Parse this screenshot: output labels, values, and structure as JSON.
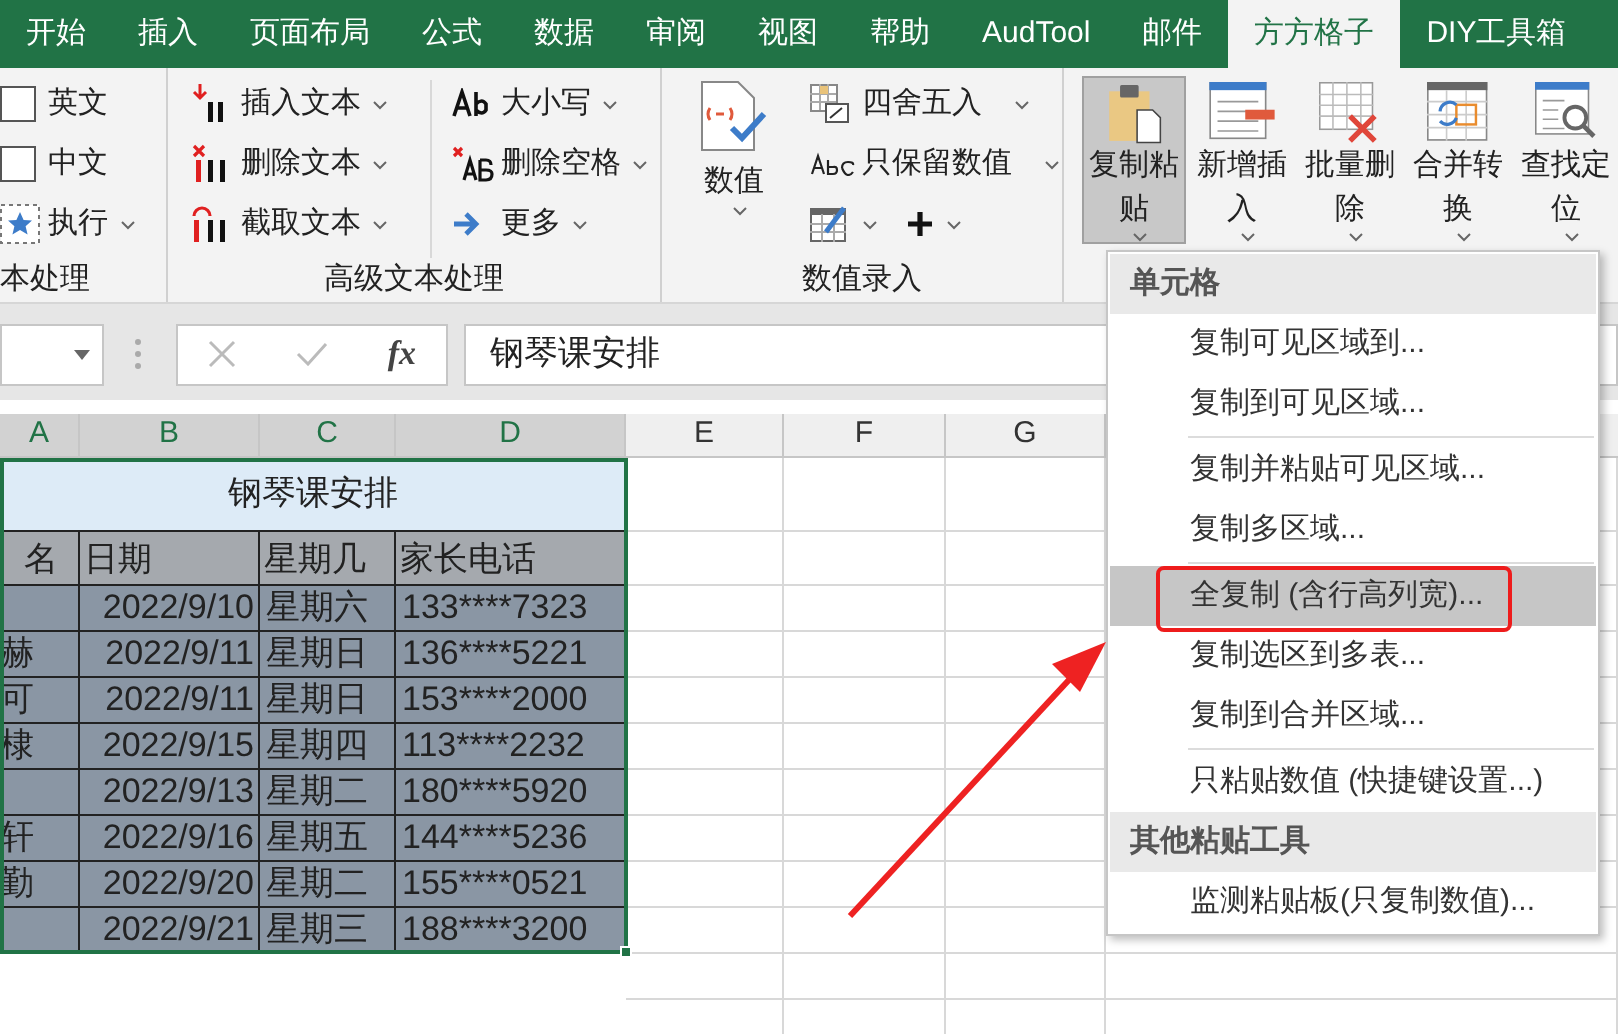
{
  "ribbon_tabs": [
    {
      "label": "开始",
      "selected": false
    },
    {
      "label": "插入",
      "selected": false
    },
    {
      "label": "页面布局",
      "selected": false
    },
    {
      "label": "公式",
      "selected": false
    },
    {
      "label": "数据",
      "selected": false
    },
    {
      "label": "审阅",
      "selected": false
    },
    {
      "label": "视图",
      "selected": false
    },
    {
      "label": "帮助",
      "selected": false
    },
    {
      "label": "AudTool",
      "selected": false
    },
    {
      "label": "邮件",
      "selected": false
    },
    {
      "label": "方方格子",
      "selected": true
    },
    {
      "label": "DIY工具箱",
      "selected": false
    }
  ],
  "ribbon": {
    "text_group": {
      "label": "本处理",
      "items": [
        {
          "kind": "checkbox",
          "label": "英文",
          "checked": false
        },
        {
          "kind": "checkbox",
          "label": "中文",
          "checked": false
        },
        {
          "kind": "command",
          "label": "执行",
          "dropdown": true
        }
      ]
    },
    "advanced_text_group": {
      "label": "高级文本处理",
      "columns": [
        [
          {
            "label": "插入文本",
            "dropdown": true
          },
          {
            "label": "删除文本",
            "dropdown": true
          },
          {
            "label": "截取文本",
            "dropdown": true
          }
        ],
        [
          {
            "label": "大小写",
            "dropdown": true
          },
          {
            "label": "删除空格",
            "dropdown": true
          },
          {
            "label": "更多",
            "dropdown": true
          }
        ]
      ]
    },
    "number_group": {
      "label": "数值录入",
      "large": {
        "label": "数值",
        "dropdown": true
      },
      "items": [
        {
          "label": "四舍五入",
          "dropdown": true
        },
        {
          "label": "只保留数值",
          "dropdown": true
        }
      ],
      "icon_items": [
        {
          "dropdown": true
        },
        {
          "dropdown": true
        }
      ]
    },
    "large_buttons": [
      {
        "label": "复制粘贴",
        "selected": true,
        "dropdown": true
      },
      {
        "label": "新增插入",
        "selected": false,
        "dropdown": true
      },
      {
        "label": "批量删除",
        "selected": false,
        "dropdown": true
      },
      {
        "label": "合并转换",
        "selected": false,
        "dropdown": true
      },
      {
        "label": "查找定位",
        "selected": false,
        "dropdown": true
      }
    ]
  },
  "formula_bar": {
    "function_label": "fx",
    "value": "钢琴课安排"
  },
  "sheet": {
    "columns": [
      {
        "label": "A",
        "selected": true
      },
      {
        "label": "B",
        "selected": true
      },
      {
        "label": "C",
        "selected": true
      },
      {
        "label": "D",
        "selected": true
      },
      {
        "label": "E",
        "selected": false
      },
      {
        "label": "F",
        "selected": false
      },
      {
        "label": "G",
        "selected": false
      }
    ],
    "title": "钢琴课安排",
    "header": [
      "名",
      "日期",
      "星期几",
      "家长电话"
    ],
    "rows": [
      [
        "",
        "2022/9/10",
        "星期六",
        "133****7323"
      ],
      [
        "赫",
        "2022/9/11",
        "星期日",
        "136****5221"
      ],
      [
        "可",
        "2022/9/11",
        "星期日",
        "153****2000"
      ],
      [
        "棣",
        "2022/9/15",
        "星期四",
        "113****2232"
      ],
      [
        "",
        "2022/9/13",
        "星期二",
        "180****5920"
      ],
      [
        "轩",
        "2022/9/16",
        "星期五",
        "144****5236"
      ],
      [
        "勤",
        "2022/9/20",
        "星期二",
        "155****0521"
      ],
      [
        "",
        "2022/9/21",
        "星期三",
        "188****3200"
      ]
    ]
  },
  "context_menu": {
    "items": [
      {
        "kind": "header",
        "label": "单元格"
      },
      {
        "kind": "item",
        "label": "复制可见区域到...",
        "selected": false
      },
      {
        "kind": "item",
        "label": "复制到可见区域...",
        "selected": false
      },
      {
        "kind": "separator"
      },
      {
        "kind": "item",
        "label": "复制并粘贴可见区域...",
        "selected": false
      },
      {
        "kind": "item",
        "label": "复制多区域...",
        "selected": false
      },
      {
        "kind": "separator"
      },
      {
        "kind": "item",
        "label": "全复制 (含行高列宽)...",
        "selected": true
      },
      {
        "kind": "item",
        "label": "复制选区到多表...",
        "selected": false
      },
      {
        "kind": "item",
        "label": "复制到合并区域...",
        "selected": false
      },
      {
        "kind": "separator"
      },
      {
        "kind": "item",
        "label": "只粘贴数值 (快捷键设置...)",
        "selected": false
      },
      {
        "kind": "header",
        "label": "其他粘贴工具"
      },
      {
        "kind": "item",
        "label": "监测粘贴板(只复制数值)...",
        "selected": false
      }
    ]
  }
}
